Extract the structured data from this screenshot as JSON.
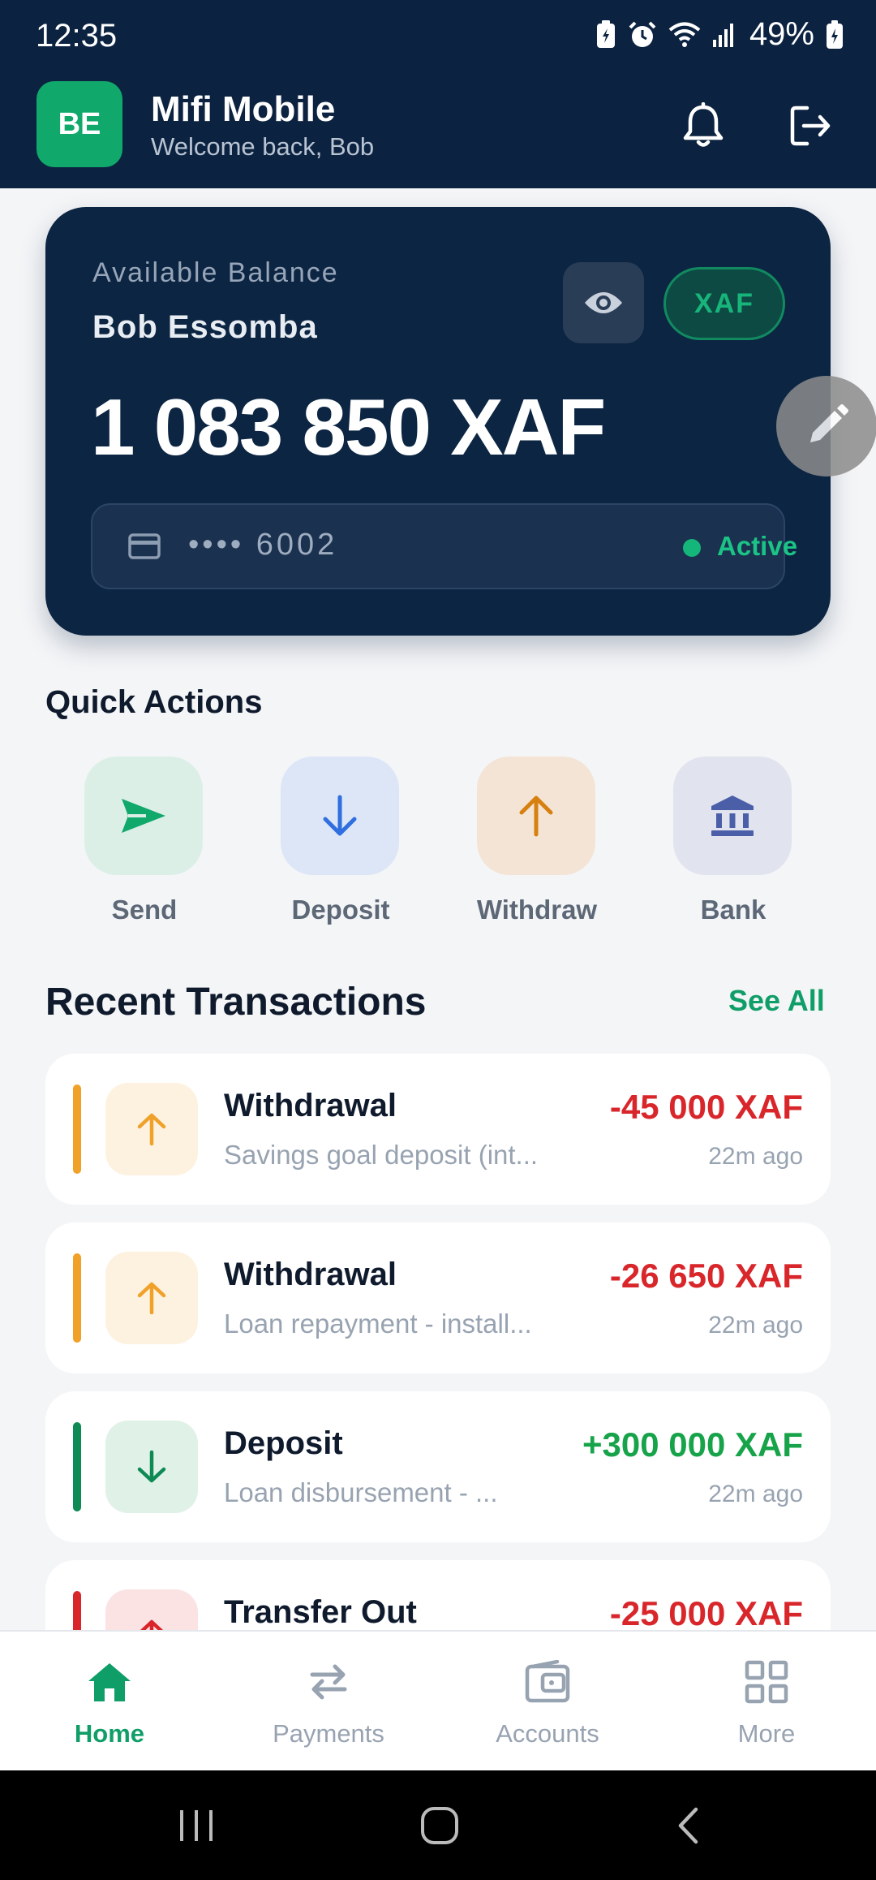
{
  "status_bar": {
    "time": "12:35",
    "battery": "49%"
  },
  "header": {
    "avatar_initials": "BE",
    "app_name": "Mifi Mobile",
    "welcome": "Welcome back, Bob"
  },
  "balance_card": {
    "label": "Available Balance",
    "owner": "Bob Essomba",
    "amount": "1 083 850 XAF",
    "currency": "XAF",
    "account_masked": "•••• 6002",
    "account_status": "Active"
  },
  "quick_actions": {
    "title": "Quick Actions",
    "items": [
      {
        "label": "Send",
        "icon": "send-icon"
      },
      {
        "label": "Deposit",
        "icon": "arrow-down-icon"
      },
      {
        "label": "Withdraw",
        "icon": "arrow-up-icon"
      },
      {
        "label": "Bank",
        "icon": "bank-icon"
      }
    ]
  },
  "transactions": {
    "title": "Recent Transactions",
    "see_all": "See All",
    "items": [
      {
        "type": "Withdrawal",
        "description": "Savings goal deposit (int...",
        "amount": "-45 000 XAF",
        "time": "22m ago",
        "kind": "withdrawal"
      },
      {
        "type": "Withdrawal",
        "description": "Loan repayment - install...",
        "amount": "-26 650 XAF",
        "time": "22m ago",
        "kind": "withdrawal"
      },
      {
        "type": "Deposit",
        "description": "Loan disbursement - ...",
        "amount": "+300 000 XAF",
        "time": "22m ago",
        "kind": "deposit"
      },
      {
        "type": "Transfer Out",
        "description": "",
        "amount": "-25 000 XAF",
        "time": "",
        "kind": "transfer"
      }
    ]
  },
  "bottom_nav": {
    "items": [
      {
        "label": "Home",
        "active": true
      },
      {
        "label": "Payments",
        "active": false
      },
      {
        "label": "Accounts",
        "active": false
      },
      {
        "label": "More",
        "active": false
      }
    ]
  },
  "colors": {
    "navy": "#0b2240",
    "brand_green": "#10a86b",
    "negative_red": "#d8262b",
    "positive_green": "#16a34a",
    "withdraw_orange": "#f0a12a"
  }
}
